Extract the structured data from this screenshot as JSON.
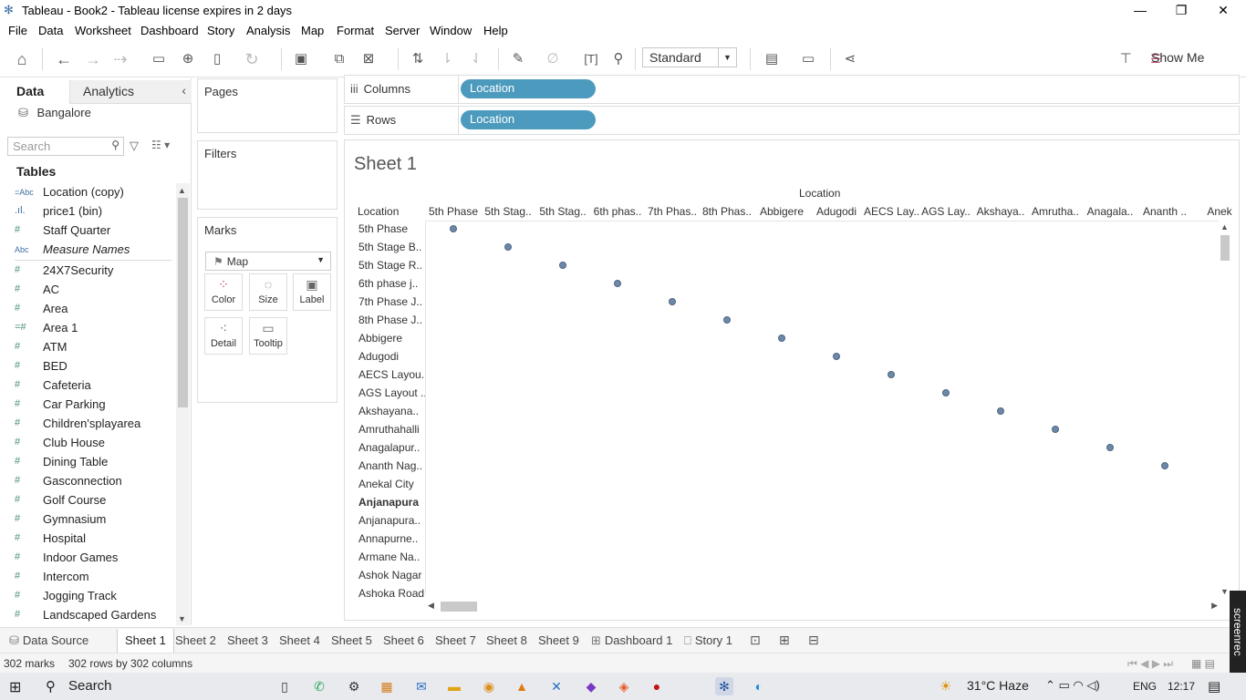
{
  "window": {
    "title": "Tableau - Book2 - Tableau license expires in 2 days",
    "minimize": "—",
    "restore": "❐",
    "close": "✕"
  },
  "menu": [
    "File",
    "Data",
    "Worksheet",
    "Dashboard",
    "Story",
    "Analysis",
    "Map",
    "Format",
    "Server",
    "Window",
    "Help"
  ],
  "toolbar": {
    "view_mode": "Standard",
    "show_me": "Show Me"
  },
  "datapane": {
    "tab_data": "Data",
    "tab_analytics": "Analytics",
    "datasource": "Bangalore",
    "search_placeholder": "Search",
    "tables_heading": "Tables",
    "fields": [
      {
        "icon": "=Abc",
        "name": "Location (copy)"
      },
      {
        "icon": ".ıl.",
        "name": "price1 (bin)"
      },
      {
        "icon": "#",
        "name": "Staff Quarter"
      },
      {
        "icon": "Abc",
        "name": "Measure Names"
      },
      {
        "icon": "#",
        "name": "24X7Security"
      },
      {
        "icon": "#",
        "name": "AC"
      },
      {
        "icon": "#",
        "name": "Area"
      },
      {
        "icon": "=#",
        "name": "Area 1"
      },
      {
        "icon": "#",
        "name": "ATM"
      },
      {
        "icon": "#",
        "name": "BED"
      },
      {
        "icon": "#",
        "name": "Cafeteria"
      },
      {
        "icon": "#",
        "name": "Car Parking"
      },
      {
        "icon": "#",
        "name": "Children'splayarea"
      },
      {
        "icon": "#",
        "name": "Club House"
      },
      {
        "icon": "#",
        "name": "Dining Table"
      },
      {
        "icon": "#",
        "name": "Gasconnection"
      },
      {
        "icon": "#",
        "name": "Golf Course"
      },
      {
        "icon": "#",
        "name": "Gymnasium"
      },
      {
        "icon": "#",
        "name": "Hospital"
      },
      {
        "icon": "#",
        "name": "Indoor Games"
      },
      {
        "icon": "#",
        "name": "Intercom"
      },
      {
        "icon": "#",
        "name": "Jogging Track"
      },
      {
        "icon": "#",
        "name": "Landscaped Gardens"
      }
    ]
  },
  "cards": {
    "pages": "Pages",
    "filters": "Filters",
    "marks": "Marks",
    "mark_type": "Map",
    "mark_buttons": [
      "Color",
      "Size",
      "Label",
      "Detail",
      "Tooltip"
    ]
  },
  "shelves": {
    "columns_label": "Columns",
    "rows_label": "Rows",
    "columns_pill": "Location",
    "rows_pill": "Location"
  },
  "viz": {
    "sheet_title": "Sheet 1",
    "column_field_label": "Location",
    "row_field_label": "Location",
    "column_headers": [
      "5th Phase",
      "5th Stag..",
      "5th Stag..",
      "6th phas..",
      "7th Phas..",
      "8th Phas..",
      "Abbigere",
      "Adugodi",
      "AECS Lay..",
      "AGS Lay..",
      "Akshaya..",
      "Amrutha..",
      "Anagala..",
      "Ananth ..",
      "Anek"
    ],
    "row_headers": [
      "5th Phase",
      "5th Stage B..",
      "5th Stage R..",
      "6th phase j..",
      "7th Phase J..",
      "8th Phase J..",
      "Abbigere",
      "Adugodi",
      "AECS Layou..",
      "AGS Layout ..",
      "Akshayana..",
      "Amruthahalli",
      "Anagalapur..",
      "Ananth Nag..",
      "Anekal City",
      "Anjanapura",
      "Anjanapura..",
      "Annapurne..",
      "Armane Na..",
      "Ashok Nagar",
      "Ashoka Road"
    ],
    "bold_row": "Anjanapura",
    "mark_color": "#6e89a8"
  },
  "tabs": [
    "Data Source",
    "Sheet 1",
    "Sheet 2",
    "Sheet 3",
    "Sheet 4",
    "Sheet 5",
    "Sheet 6",
    "Sheet 7",
    "Sheet 8",
    "Sheet 9",
    "Dashboard 1",
    "Story 1"
  ],
  "active_tab": "Sheet 1",
  "status": {
    "marks": "302 marks",
    "rows_cols": "302 rows by 302 columns"
  },
  "taskbar": {
    "search": "Search",
    "weather": "31°C  Haze",
    "lang": "ENG",
    "time": "12:17"
  },
  "screenrec": "screenrec"
}
